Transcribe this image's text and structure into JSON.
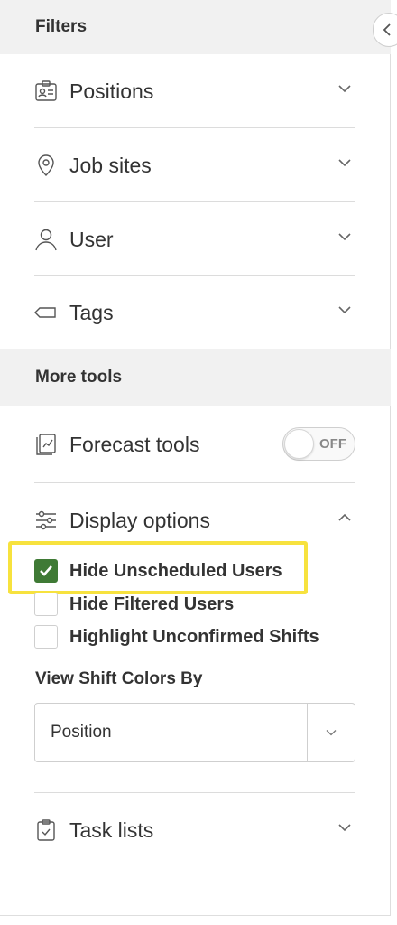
{
  "filters": {
    "title": "Filters",
    "items": [
      {
        "label": "Positions",
        "icon": "badge-icon"
      },
      {
        "label": "Job sites",
        "icon": "map-pin-icon"
      },
      {
        "label": "User",
        "icon": "user-icon"
      },
      {
        "label": "Tags",
        "icon": "tag-icon"
      }
    ]
  },
  "more_tools": {
    "title": "More tools",
    "forecast": {
      "label": "Forecast tools",
      "toggle": "OFF",
      "icon": "forecast-icon"
    },
    "display": {
      "label": "Display options",
      "icon": "sliders-icon",
      "options": [
        {
          "label": "Hide Unscheduled Users",
          "checked": true
        },
        {
          "label": "Hide Filtered Users",
          "checked": false
        },
        {
          "label": "Highlight Unconfirmed Shifts",
          "checked": false
        }
      ],
      "color_by_label": "View Shift Colors By",
      "color_by_value": "Position"
    },
    "task_lists": {
      "label": "Task lists",
      "icon": "clipboard-check-icon"
    }
  },
  "colors": {
    "accent": "#3f7a35",
    "highlight": "#f7e23e",
    "header_bg": "#f1f1f1"
  }
}
